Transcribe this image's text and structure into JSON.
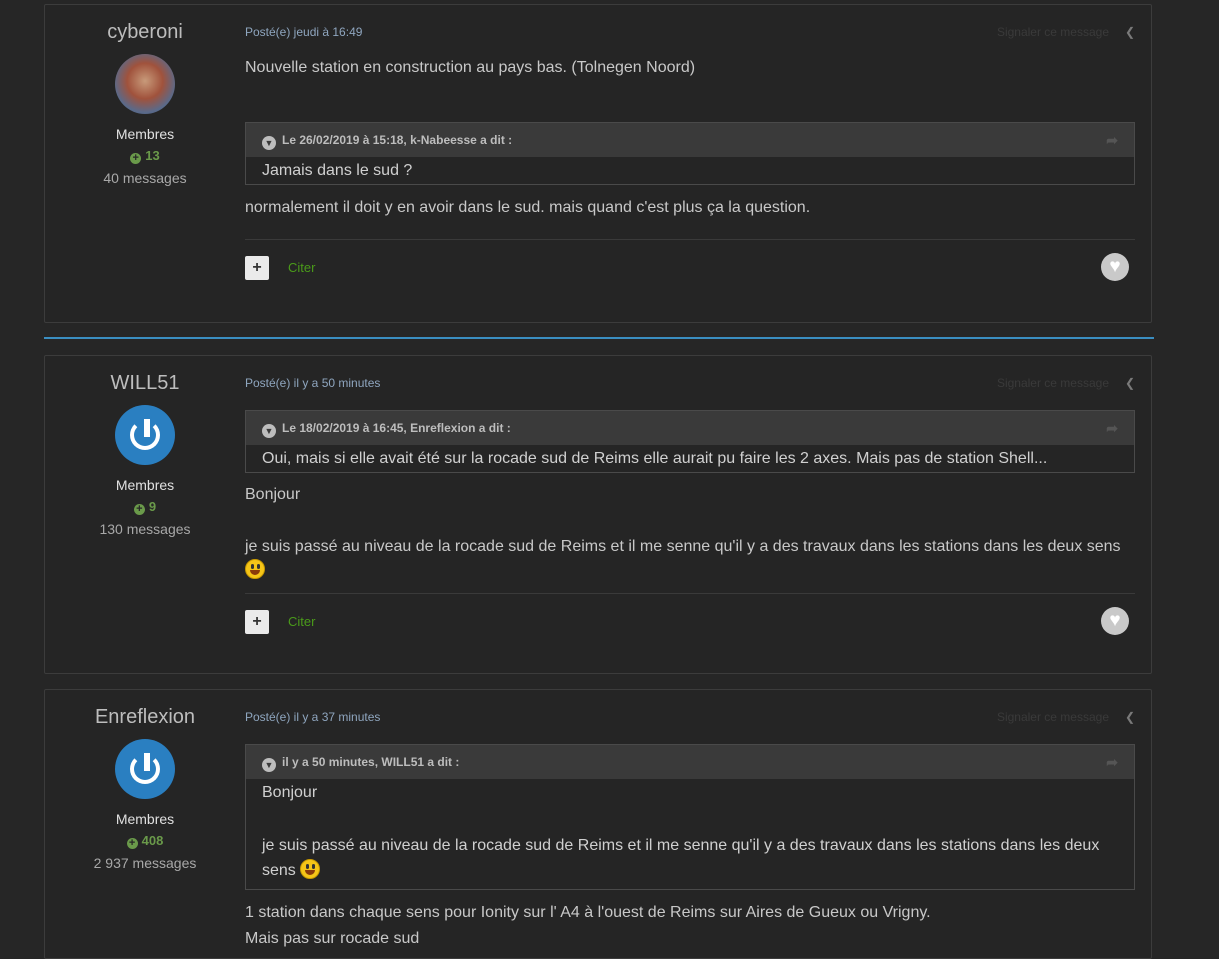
{
  "posts": [
    {
      "author": "cyberoni",
      "group": "Membres",
      "reputation": "13",
      "messages": "40 messages",
      "posted": "Posté(e) jeudi à 16:49",
      "report": "Signaler ce message",
      "intro": "Nouvelle station en construction au pays bas. (Tolnegen Noord)",
      "quote_header": "Le 26/02/2019 à 15:18, k-Nabeesse a dit :",
      "quote_text": "Jamais dans le sud ?",
      "reply": "normalement il doit y en avoir dans le sud. mais quand c'est plus ça la question.",
      "cite": "Citer"
    },
    {
      "author": "WILL51",
      "group": "Membres",
      "reputation": "9",
      "messages": "130 messages",
      "posted": "Posté(e) il y a 50 minutes",
      "report": "Signaler ce message",
      "quote_header": "Le 18/02/2019 à 16:45, Enreflexion a dit :",
      "quote_text": "Oui, mais si elle avait été sur la rocade sud de Reims elle aurait pu faire les 2 axes. Mais pas de station Shell...",
      "reply_line1": "Bonjour",
      "reply_line2": "je suis passé au niveau de la rocade sud de Reims et il me senne qu'il y a des travaux dans les stations dans les deux sens",
      "cite": "Citer"
    },
    {
      "author": "Enreflexion",
      "group": "Membres",
      "reputation": "408",
      "messages": "2 937 messages",
      "posted": "Posté(e) il y a 37 minutes",
      "report": "Signaler ce message",
      "quote_header": "il y a 50 minutes, WILL51 a dit :",
      "quote_line1": "Bonjour",
      "quote_line2": "je suis passé au niveau de la rocade sud de Reims et il me senne qu'il y a des travaux dans les stations dans les deux sens",
      "reply_line1": "1 station dans chaque sens pour Ionity sur l' A4 à l'ouest de Reims sur  Aires de Gueux ou Vrigny.",
      "reply_line2": "Mais pas sur rocade sud"
    }
  ],
  "colors": {
    "accent": "#3a8ec1",
    "cite": "#4a9a1a",
    "reputation": "#6a9a4a"
  }
}
